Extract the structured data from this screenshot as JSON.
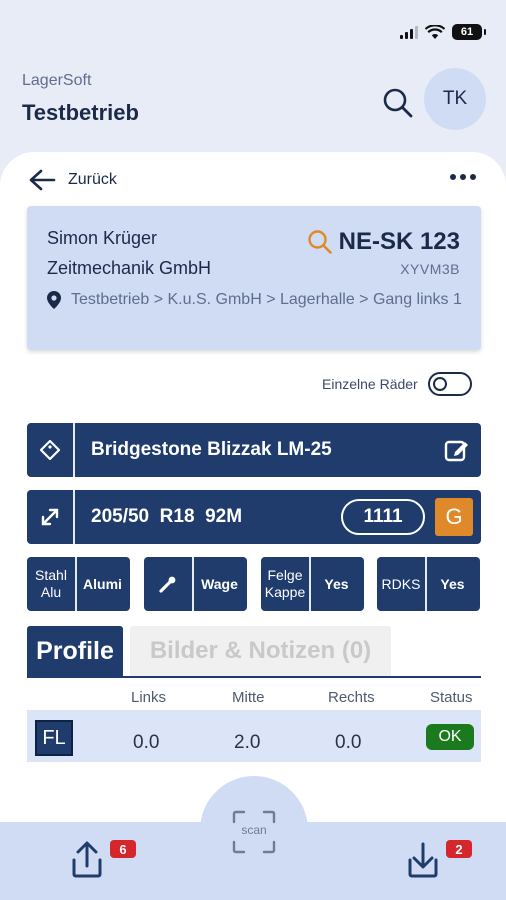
{
  "status_bar": {
    "battery": "61"
  },
  "header": {
    "brand": "LagerSoft",
    "company": "Testbetrieb",
    "avatar_initials": "TK"
  },
  "nav": {
    "back_label": "Zurück"
  },
  "customer": {
    "name": "Simon Krüger",
    "company": "Zeitmechanik GmbH",
    "plate": "NE-SK 123",
    "code": "XYVM3B",
    "location": "Testbetrieb > K.u.S. GmbH > Lagerhalle > Gang links 1"
  },
  "toggle": {
    "label": "Einzelne Räder",
    "on": false
  },
  "tire": {
    "model": "Bridgestone Blizzak LM-25",
    "size": "205/50  R18  92M",
    "count": "1111",
    "grade": "G"
  },
  "options": [
    {
      "label": "Stahl Alu",
      "value": "Alumi"
    },
    {
      "label": "",
      "value": "Wage"
    },
    {
      "label": "Felge Kappe",
      "value": "Yes"
    },
    {
      "label": "RDKS",
      "value": "Yes"
    }
  ],
  "tabs": {
    "profile": "Profile",
    "images": "Bilder & Notizen (0)"
  },
  "table": {
    "headers": [
      "Links",
      "Mitte",
      "Rechts",
      "Status"
    ],
    "rows": [
      {
        "pos": "FL",
        "links": "0.0",
        "mitte": "2.0",
        "rechts": "0.0",
        "status": "OK"
      }
    ]
  },
  "bottom": {
    "scan_label": "scan",
    "upload_count": "6",
    "download_count": "2"
  },
  "colors": {
    "primary": "#1f3c6d",
    "accent": "#e0892a",
    "light": "#cfdcf4",
    "ok": "#1c7a1e",
    "badge": "#d4262b"
  }
}
